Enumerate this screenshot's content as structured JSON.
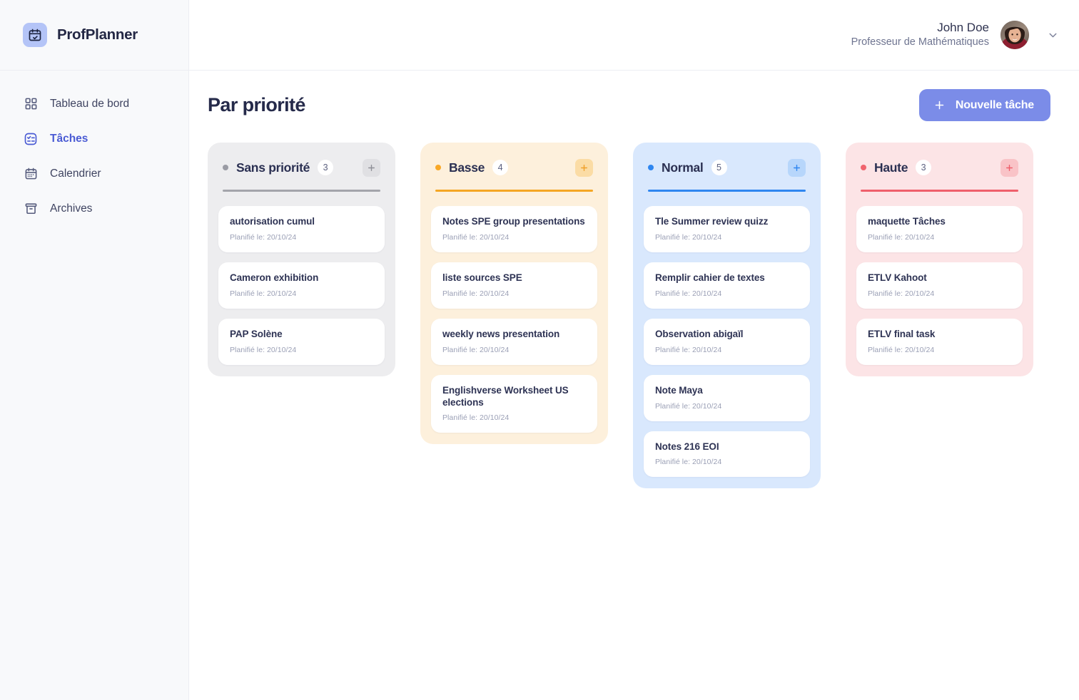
{
  "brand": {
    "name": "ProfPlanner",
    "logo_icon": "calendar-check-icon",
    "logo_bg": "#b4c4f7"
  },
  "sidebar": {
    "items": [
      {
        "label": "Tableau de bord",
        "icon": "grid-icon",
        "active": false
      },
      {
        "label": "Tâches",
        "icon": "checklist-icon",
        "active": true
      },
      {
        "label": "Calendrier",
        "icon": "calendar-icon",
        "active": false
      },
      {
        "label": "Archives",
        "icon": "archive-icon",
        "active": false
      }
    ]
  },
  "topbar": {
    "user_name": "John Doe",
    "user_role": "Professeur de Mathématiques",
    "avatar_icon": "user-avatar-photo",
    "chevron_icon": "chevron-down-icon"
  },
  "content": {
    "page_title": "Par priorité",
    "new_task_label": "Nouvelle tâche",
    "new_task_icon": "plus-icon",
    "accent_color": "#7b8ce8"
  },
  "board": {
    "add_icon": "plus-icon",
    "columns": [
      {
        "title": "Sans priorité",
        "count": "3",
        "dot_color": "#9a9ba4",
        "bg_color": "#ededef",
        "rule_color": "#a3a4ab",
        "tasks": [
          {
            "title": "autorisation cumul",
            "meta": "Planifié le: 20/10/24"
          },
          {
            "title": "Cameron exhibition",
            "meta": "Planifié le: 20/10/24"
          },
          {
            "title": "PAP Solène",
            "meta": "Planifié le: 20/10/24"
          }
        ]
      },
      {
        "title": "Basse",
        "count": "4",
        "dot_color": "#f9a826",
        "bg_color": "#fdf0dc",
        "rule_color": "#f5a623",
        "tasks": [
          {
            "title": "Notes SPE group presentations",
            "meta": "Planifié le: 20/10/24"
          },
          {
            "title": "liste sources SPE",
            "meta": "Planifié le: 20/10/24"
          },
          {
            "title": "weekly news presentation",
            "meta": "Planifié le: 20/10/24"
          },
          {
            "title": "Englishverse Worksheet US elections",
            "meta": "Planifié le: 20/10/24"
          }
        ]
      },
      {
        "title": "Normal",
        "count": "5",
        "dot_color": "#2f86f0",
        "bg_color": "#d9e8fd",
        "rule_color": "#2f86f0",
        "tasks": [
          {
            "title": "Tle Summer review quizz",
            "meta": "Planifié le: 20/10/24"
          },
          {
            "title": "Remplir cahier de textes",
            "meta": "Planifié le: 20/10/24"
          },
          {
            "title": "Observation abigaïl",
            "meta": "Planifié le: 20/10/24"
          },
          {
            "title": "Note Maya",
            "meta": "Planifié le: 20/10/24"
          },
          {
            "title": "Notes 216 EOI",
            "meta": "Planifié le: 20/10/24"
          }
        ]
      },
      {
        "title": "Haute",
        "count": "3",
        "dot_color": "#f0646e",
        "bg_color": "#fce4e6",
        "rule_color": "#ef5f6b",
        "tasks": [
          {
            "title": "maquette Tâches",
            "meta": "Planifié le: 20/10/24"
          },
          {
            "title": "ETLV Kahoot",
            "meta": "Planifié le: 20/10/24"
          },
          {
            "title": "ETLV final task",
            "meta": "Planifié le: 20/10/24"
          }
        ]
      }
    ]
  }
}
